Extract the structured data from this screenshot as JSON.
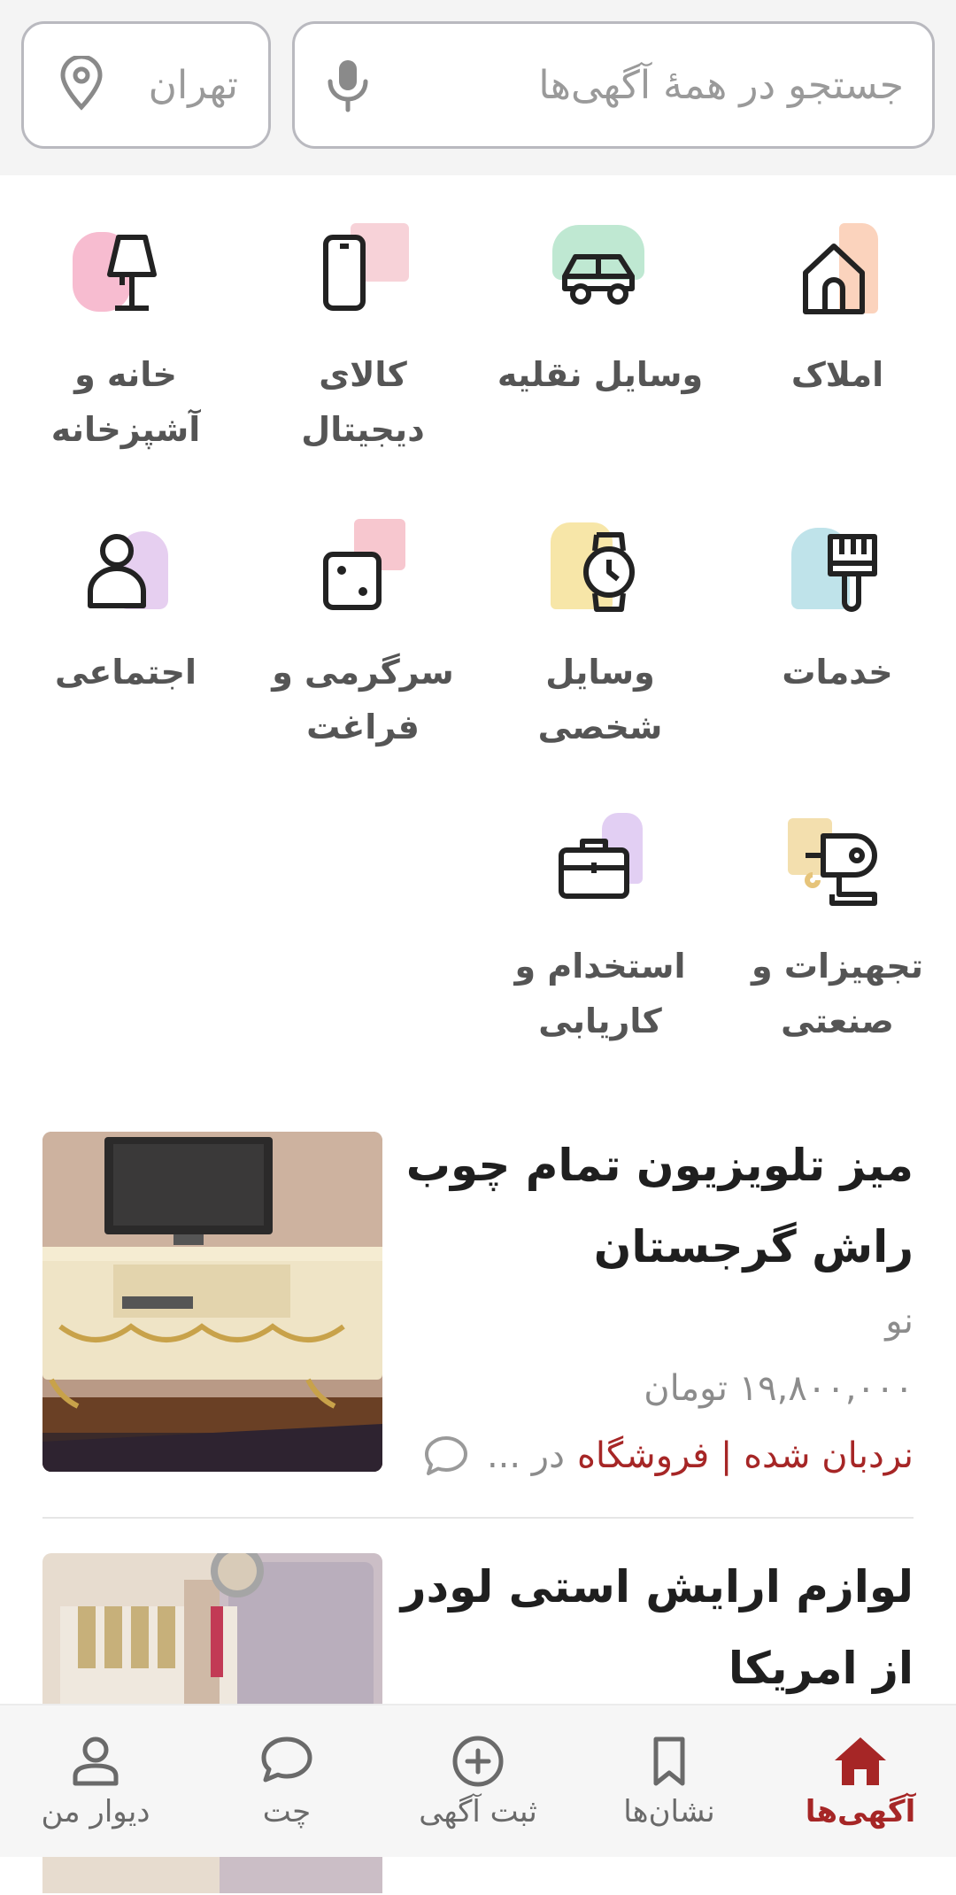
{
  "search": {
    "placeholder": "جستجو در همهٔ آگهی‌ها"
  },
  "city": {
    "label": "تهران"
  },
  "categories": [
    {
      "label_line1": "املاک",
      "label_line2": "",
      "icon": "house-icon",
      "accent": "#fbd3bd"
    },
    {
      "label_line1": "وسایل نقلیه",
      "label_line2": "",
      "icon": "car-icon",
      "accent": "#bfe8d2"
    },
    {
      "label_line1": "کالای",
      "label_line2": "دیجیتال",
      "icon": "phone-icon",
      "accent": "#f7d2d8"
    },
    {
      "label_line1": "خانه و",
      "label_line2": "آشپزخانه",
      "icon": "lamp-icon",
      "accent": "#f7bcd0"
    },
    {
      "label_line1": "خدمات",
      "label_line2": "",
      "icon": "paintbrush-icon",
      "accent": "#bfe3ea"
    },
    {
      "label_line1": "وسایل",
      "label_line2": "شخصی",
      "icon": "watch-icon",
      "accent": "#f7e6a8"
    },
    {
      "label_line1": "سرگرمی و",
      "label_line2": "فراغت",
      "icon": "dice-icon",
      "accent": "#f7c7cf"
    },
    {
      "label_line1": "اجتماعی",
      "label_line2": "",
      "icon": "person-icon",
      "accent": "#e6cff0"
    },
    {
      "label_line1": "تجهیزات و",
      "label_line2": "صنعتی",
      "icon": "drill-icon",
      "accent": "#f3dfae"
    },
    {
      "label_line1": "استخدام و",
      "label_line2": "کاریابی",
      "icon": "briefcase-icon",
      "accent": "#e2cff3"
    }
  ],
  "ads": [
    {
      "title": "میز تلویزیون تمام چوب راش گرجستان",
      "condition": "نو",
      "price": "۱۹,۸۰۰,۰۰۰ تومان",
      "status": "نردبان شده | فروشگاه",
      "location": "در ...",
      "chat_icon": "chat-bubble-icon"
    },
    {
      "title": "لوازم ارایش استی لودر از امریکا"
    }
  ],
  "bottom_nav": [
    {
      "label": "آگهی‌ها",
      "icon": "home-icon",
      "active": true
    },
    {
      "label": "نشان‌ها",
      "icon": "bookmark-icon",
      "active": false
    },
    {
      "label": "ثبت آگهی",
      "icon": "plus-circle-icon",
      "active": false
    },
    {
      "label": "چت",
      "icon": "chat-icon",
      "active": false
    },
    {
      "label": "دیوار من",
      "icon": "user-icon",
      "active": false
    }
  ],
  "colors": {
    "accent": "#a62626",
    "border": "#b9b9bf",
    "text": "#3d3d3d"
  }
}
